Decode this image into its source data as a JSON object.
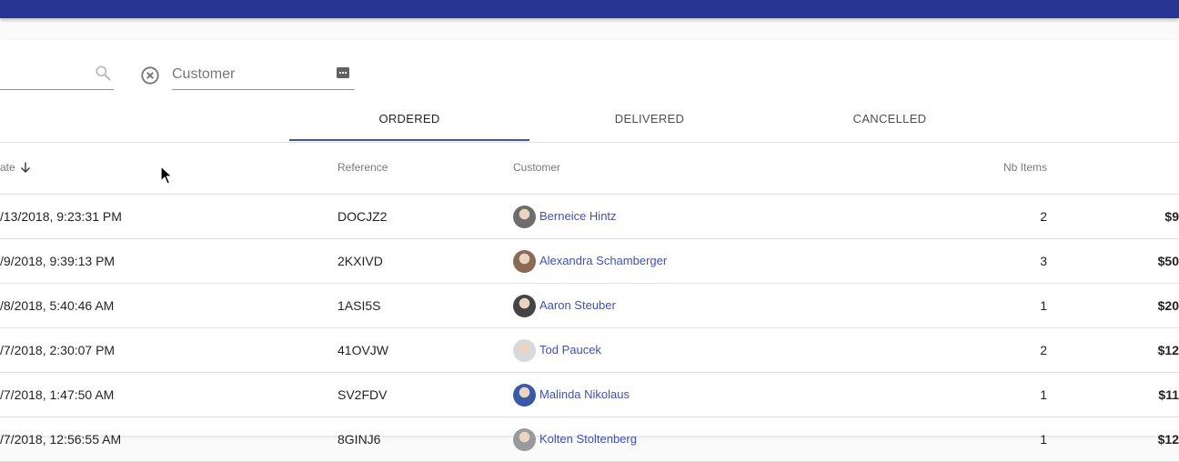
{
  "filters": {
    "search_icon": "search-icon",
    "clear_icon": "close-circle-icon",
    "customer_placeholder": "Customer",
    "customer_value": "",
    "dropdown_icon": "dropdown-icon"
  },
  "tabs": [
    {
      "label": "ORDERED",
      "active": true
    },
    {
      "label": "DELIVERED",
      "active": false
    },
    {
      "label": "CANCELLED",
      "active": false
    }
  ],
  "table": {
    "columns": {
      "date": "ate",
      "reference": "Reference",
      "customer": "Customer",
      "nb_items": "Nb Items"
    },
    "sort_icon": "arrow-down-icon",
    "rows": [
      {
        "date": "/13/2018, 9:23:31 PM",
        "reference": "DOCJZ2",
        "customer": "Berneice Hintz",
        "nb_items": "2",
        "total": "$9",
        "avatar_color": "#6d6d6d"
      },
      {
        "date": "/9/2018, 9:39:13 PM",
        "reference": "2KXIVD",
        "customer": "Alexandra Schamberger",
        "nb_items": "3",
        "total": "$50",
        "avatar_color": "#8a6a55"
      },
      {
        "date": "/8/2018, 5:40:46 AM",
        "reference": "1ASI5S",
        "customer": "Aaron Steuber",
        "nb_items": "1",
        "total": "$20",
        "avatar_color": "#444444"
      },
      {
        "date": "/7/2018, 2:30:07 PM",
        "reference": "41OVJW",
        "customer": "Tod Paucek",
        "nb_items": "2",
        "total": "$12",
        "avatar_color": "#d9d9d9"
      },
      {
        "date": "/7/2018, 1:47:50 AM",
        "reference": "SV2FDV",
        "customer": "Malinda Nikolaus",
        "nb_items": "1",
        "total": "$11",
        "avatar_color": "#3a5aa8"
      },
      {
        "date": "/7/2018, 12:56:55 AM",
        "reference": "8GINJ6",
        "customer": "Kolten Stoltenberg",
        "nb_items": "1",
        "total": "$12",
        "avatar_color": "#9a9a9a"
      }
    ]
  },
  "colors": {
    "appbar": "#283593",
    "accent": "#3f51b5"
  }
}
